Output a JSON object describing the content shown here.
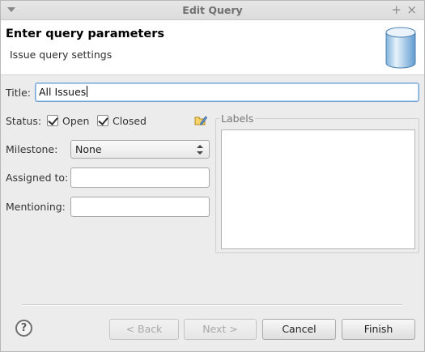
{
  "window": {
    "title": "Edit Query"
  },
  "header": {
    "title": "Enter query parameters",
    "subtitle": "Issue query settings",
    "icon": "database-icon"
  },
  "form": {
    "title_label": "Title:",
    "title_value": "All Issues",
    "status_label": "Status:",
    "status_options": [
      {
        "label": "Open",
        "checked": true
      },
      {
        "label": "Closed",
        "checked": true
      }
    ],
    "milestone_label": "Milestone:",
    "milestone_value": "None",
    "assigned_label": "Assigned to:",
    "assigned_value": "",
    "mentioning_label": "Mentioning:",
    "mentioning_value": "",
    "labels_group_title": "Labels",
    "labels_items": []
  },
  "buttons": {
    "help": "?",
    "back": "< Back",
    "next": "Next >",
    "cancel": "Cancel",
    "finish": "Finish"
  },
  "colors": {
    "focus_border": "#6fa3d6",
    "window_bg": "#ececec"
  }
}
